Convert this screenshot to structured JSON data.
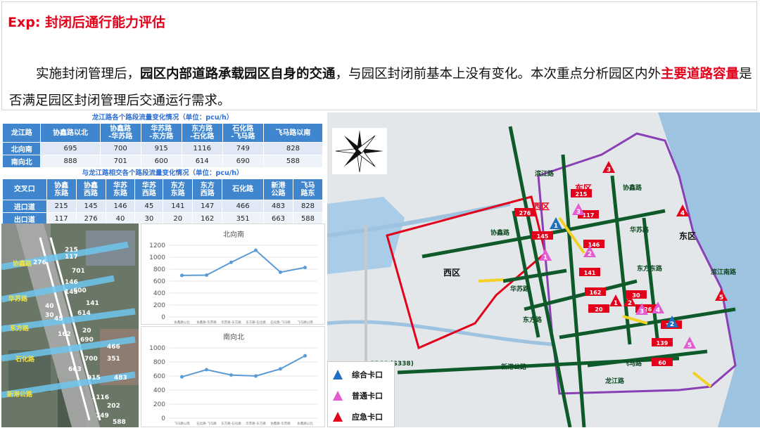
{
  "header": {
    "title": "Exp: 封闭后通行能力评估",
    "para_1": "实施封闭管理后，",
    "para_2": "园区内部道路承载园区自身的交通",
    "para_3": "，与园区封闭前基本上没有变化。本次重点分析园区内外",
    "para_4": "主要道路容量",
    "para_5": "是否满足园区封闭管理后交通运行需求。"
  },
  "table1": {
    "caption": "龙江路各个路段流量变化情况（单位：pcu/h）",
    "headers": [
      "龙江路",
      "协鑫路以北",
      "协鑫路\n-华苏路",
      "华苏路\n-东方路",
      "东方路\n-石化路",
      "石化路\n-飞马路",
      "飞马路以南"
    ],
    "rows": [
      {
        "label": "北向南",
        "values": [
          "695",
          "700",
          "915",
          "1116",
          "749",
          "828"
        ]
      },
      {
        "label": "南向北",
        "values": [
          "888",
          "701",
          "600",
          "614",
          "690",
          "588"
        ]
      }
    ]
  },
  "table2": {
    "caption": "与龙江路相交各个路段流量变化情况（单位：pcu/h）",
    "headers": [
      "交叉口",
      "协鑫\n东路",
      "协鑫\n西路",
      "华苏\n东路",
      "华苏\n西路",
      "东方\n东路",
      "东方\n西路",
      "石化路",
      "新港\n公路",
      "飞马\n路东"
    ],
    "rows": [
      {
        "label": "进口道",
        "values": [
          "215",
          "145",
          "146",
          "45",
          "141",
          "147",
          "466",
          "483",
          "828"
        ]
      },
      {
        "label": "出口道",
        "values": [
          "117",
          "276",
          "40",
          "30",
          "20",
          "162",
          "351",
          "663",
          "588"
        ]
      }
    ]
  },
  "aerial": {
    "roads": [
      "协鑫路",
      "华苏路",
      "东方路",
      "石化路",
      "新港公路"
    ],
    "labels": [
      "215",
      "276",
      "117",
      "146",
      "145",
      "40",
      "30",
      "45",
      "141",
      "162",
      "20",
      "466",
      "663",
      "351",
      "483",
      "202",
      "588",
      "701",
      "600",
      "614",
      "690",
      "700",
      "915",
      "1116",
      "749"
    ]
  },
  "chart_data": [
    {
      "type": "line",
      "title": "北向南",
      "categories": [
        "协鑫路以北",
        "协鑫路-华苏路",
        "华苏路-东方路",
        "东方路-石化路",
        "石化路-飞马路",
        "飞马路以南"
      ],
      "values": [
        695,
        700,
        915,
        1116,
        749,
        828
      ],
      "ylim": [
        0,
        1200
      ],
      "yticks": [
        "0",
        "200",
        "400",
        "600",
        "800",
        "1000",
        "1200"
      ],
      "color": "#5b9bd5"
    },
    {
      "type": "line",
      "title": "南向北",
      "categories": [
        "飞马路以南",
        "石化路-飞马路",
        "东方路-石化路",
        "华苏路-东方路",
        "协鑫路-华苏路",
        "协鑫路以北"
      ],
      "values": [
        588,
        690,
        614,
        600,
        701,
        888
      ],
      "ylim": [
        0,
        1000
      ],
      "yticks": [
        "0",
        "200",
        "400",
        "600",
        "800",
        "1000"
      ],
      "color": "#5b9bd5"
    }
  ],
  "map": {
    "districts": [
      "东区",
      "西区",
      "西区",
      "东区"
    ],
    "roads": [
      "协鑫路",
      "华苏路",
      "东方路",
      "新港公路",
      "龙江路",
      "飞马路",
      "滨江路",
      "滨江南路",
      "东方东路",
      "协鑫路",
      "华苏路",
      "G346 (S338)"
    ],
    "flows": [
      "276",
      "145",
      "215",
      "117",
      "146",
      "141",
      "20",
      "162",
      "226",
      "178",
      "139",
      "60",
      "30"
    ],
    "markers": [
      "1",
      "2",
      "3",
      "1",
      "2",
      "3",
      "4",
      "5",
      "1",
      "2",
      "3",
      "4",
      "5"
    ]
  },
  "legend": {
    "items": [
      {
        "label": "综合卡口",
        "color": "#1e6fbf"
      },
      {
        "label": "普通卡口",
        "color": "#e25bd0"
      },
      {
        "label": "应急卡口",
        "color": "#e3001b"
      }
    ]
  }
}
